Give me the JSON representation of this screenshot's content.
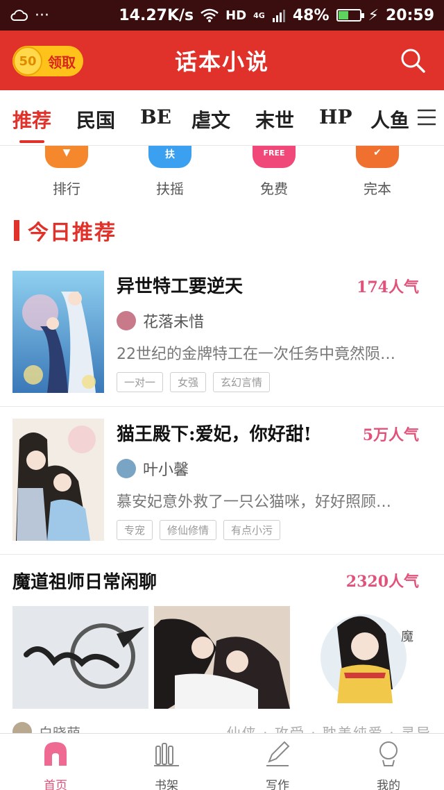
{
  "status_bar": {
    "network_speed": "14.27K/s",
    "network_type": "HD",
    "network_gen": "4G",
    "battery": "48%",
    "battery_level": 0.48,
    "time": "20:59",
    "left_icons": [
      "cloud-icon",
      "more-dots"
    ]
  },
  "header": {
    "reward_amount": "50",
    "reward_label": "领取",
    "title": "话本小说",
    "search_icon": "search-icon"
  },
  "tabs": {
    "items": [
      "推荐",
      "民国",
      "BE",
      "虐文",
      "末世",
      "HP",
      "人鱼"
    ],
    "active_index": 0
  },
  "quick_entries": [
    {
      "label": "排行",
      "icon": "ranking-icon",
      "color": "#f5872d"
    },
    {
      "label": "扶摇",
      "icon": "fuyao-icon",
      "badge": "扶",
      "color": "#3ba0f0"
    },
    {
      "label": "免费",
      "icon": "free-icon",
      "badge": "FREE",
      "color": "#f04878"
    },
    {
      "label": "完本",
      "icon": "complete-icon",
      "color": "#f07030"
    }
  ],
  "section": {
    "title": "今日推荐"
  },
  "books": [
    {
      "title": "异世特工要逆天",
      "popularity": "174人气",
      "author": "花落未惜",
      "description": "22世纪的金牌特工在一次任务中竟然陨…",
      "tags": [
        "一对一",
        "女强",
        "玄幻言情"
      ]
    },
    {
      "title": "猫王殿下:爱妃，你好甜!",
      "popularity": "5万人气",
      "author": "叶小馨",
      "description": "慕安妃意外救了一只公猫咪，好好照顾…",
      "tags": [
        "专宠",
        "修仙修情",
        "有点小污"
      ]
    }
  ],
  "wide_card": {
    "title": "魔道祖师日常闲聊",
    "popularity": "2320人气",
    "author": "白晓萌",
    "tags_text": "仙侠 · 攻受 · 耽美纯爱 · 灵异"
  },
  "bottom_nav": {
    "items": [
      {
        "label": "首页",
        "icon": "home-icon"
      },
      {
        "label": "书架",
        "icon": "bookshelf-icon"
      },
      {
        "label": "写作",
        "icon": "pen-icon"
      },
      {
        "label": "我的",
        "icon": "profile-icon"
      }
    ],
    "active_index": 0
  },
  "colors": {
    "brand_red": "#e0312a",
    "popularity_pink": "#e0527a",
    "status_bar": "#3a0e0e",
    "reward_yellow": "#ffc21b"
  }
}
